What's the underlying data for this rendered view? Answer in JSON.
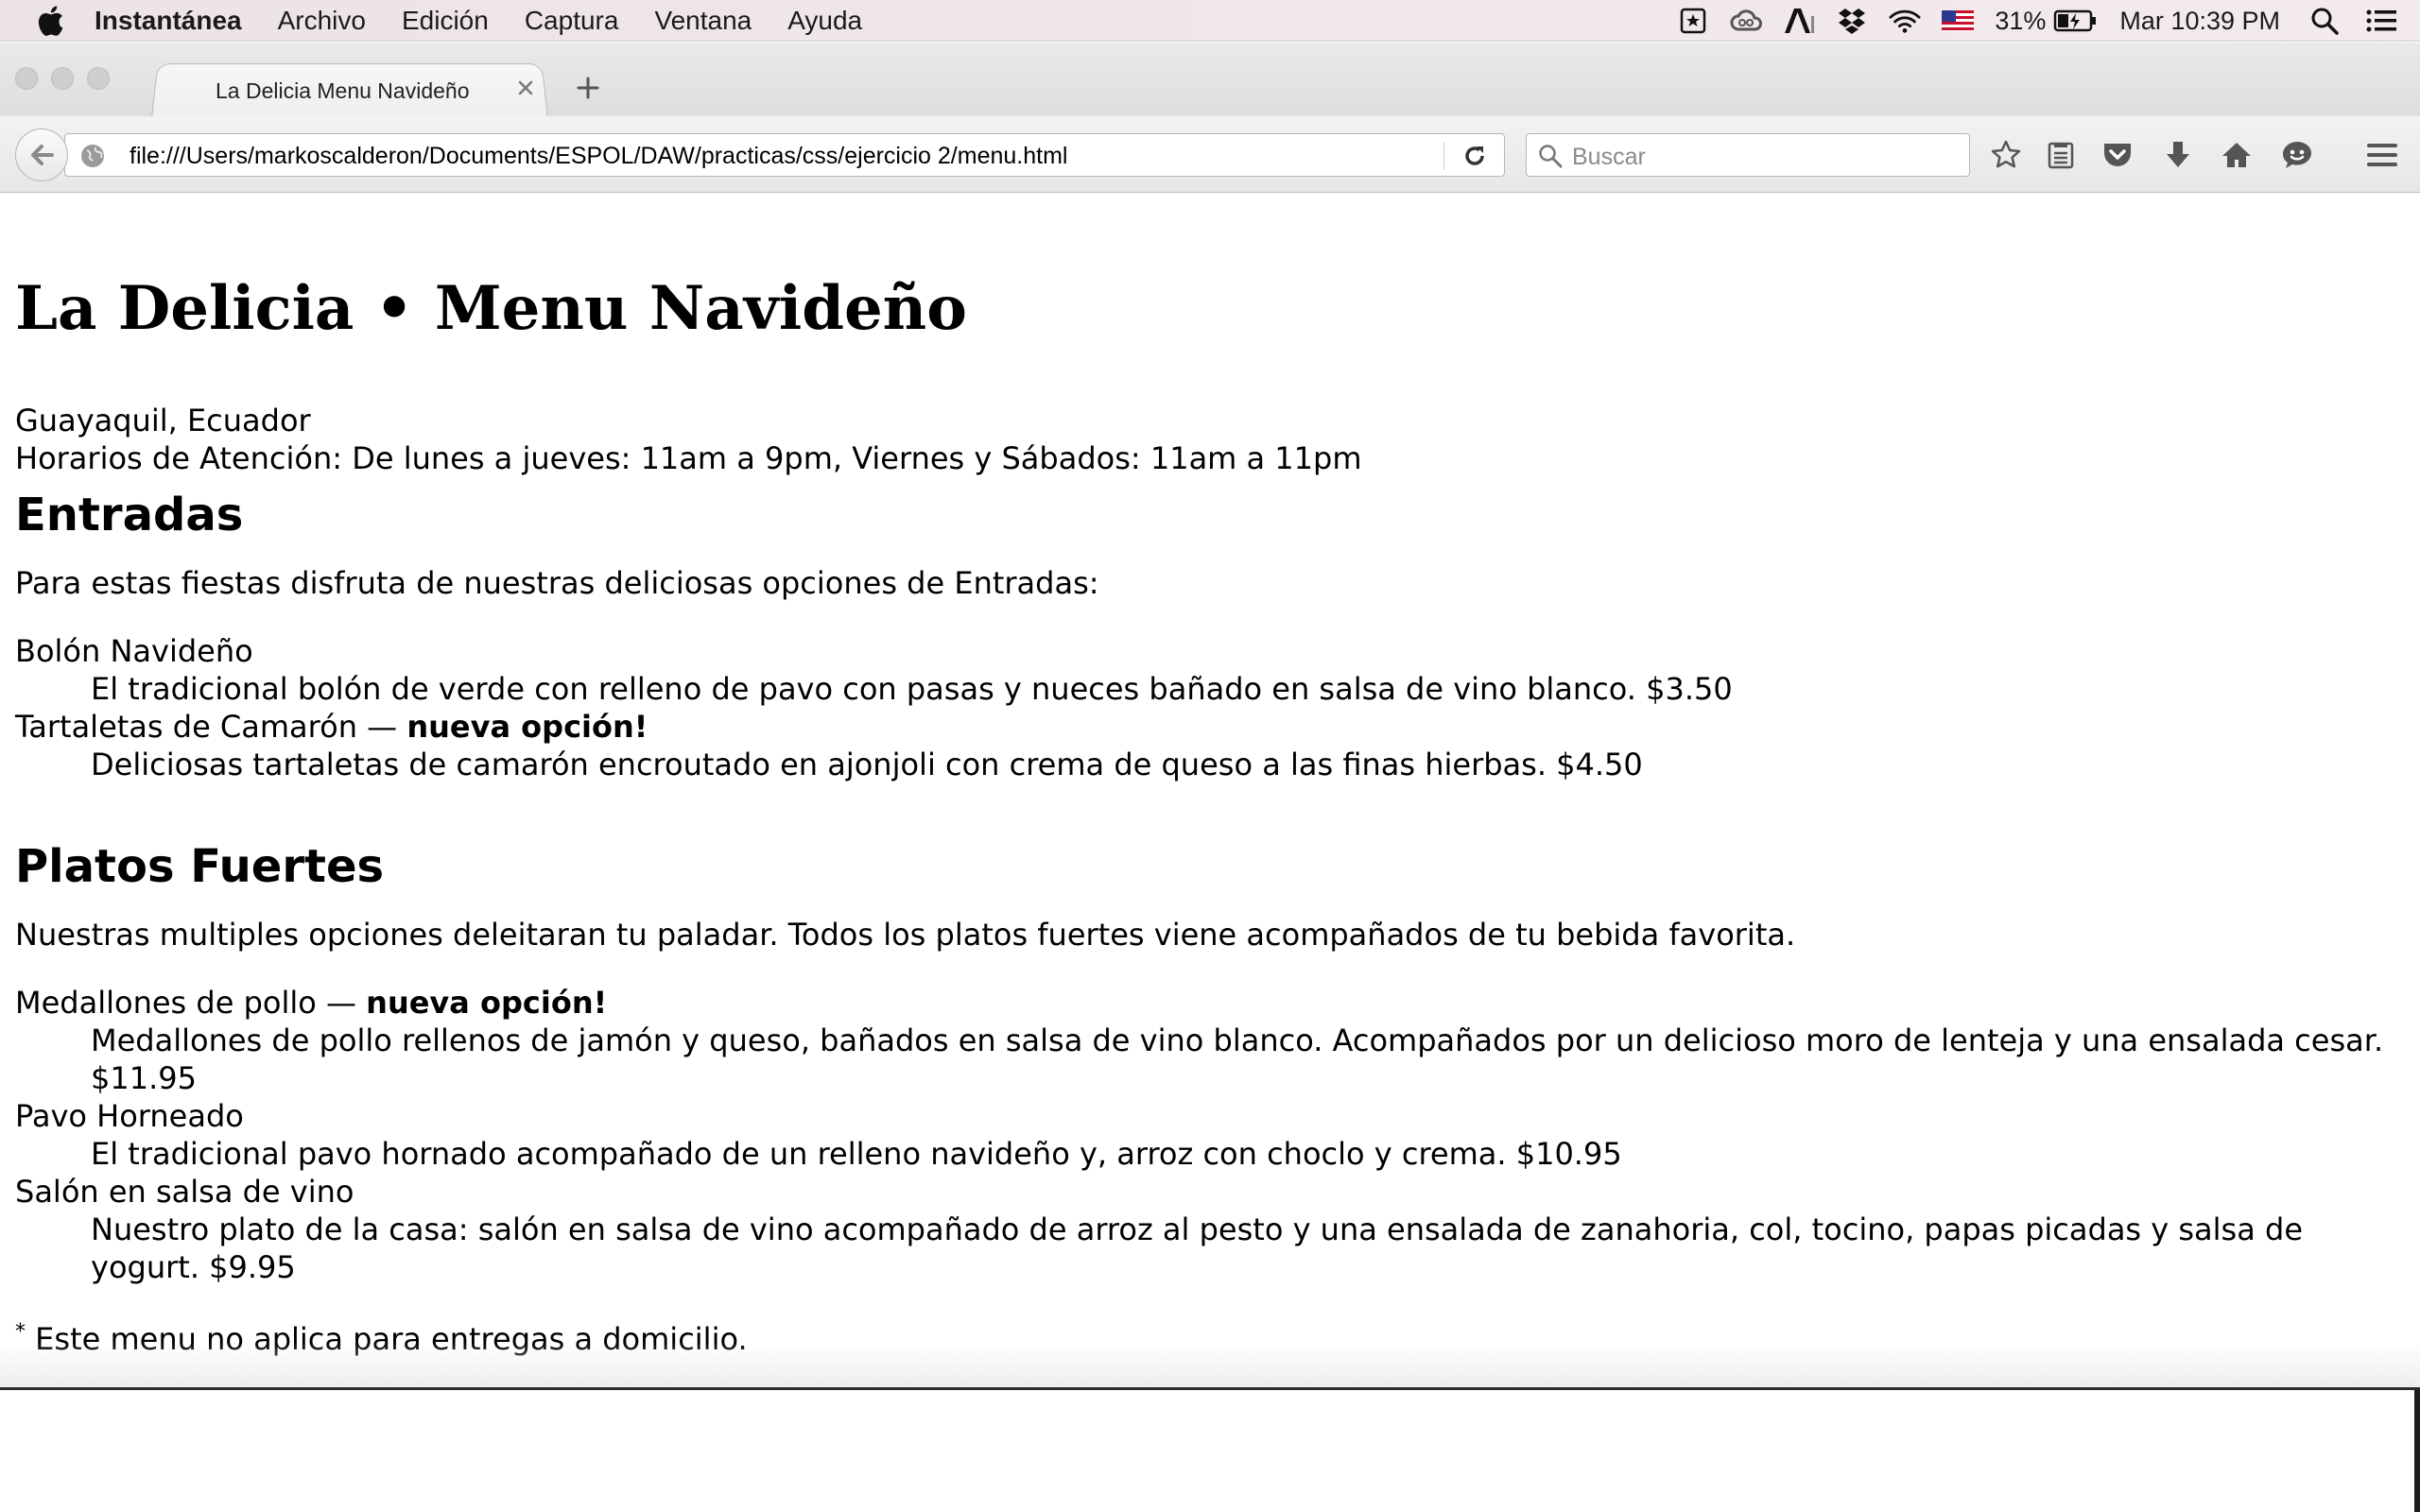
{
  "menubar": {
    "app_name": "Instantánea",
    "items": [
      "Archivo",
      "Edición",
      "Captura",
      "Ventana",
      "Ayuda"
    ],
    "battery": "31%",
    "datetime": "Mar 10:39 PM",
    "icons": [
      "apple-icon",
      "bookmark-app-icon",
      "creative-cloud-icon",
      "adobe-icon",
      "dropbox-icon",
      "wifi-icon",
      "us-flag-icon",
      "battery-icon",
      "spotlight-icon",
      "notification-center-icon"
    ]
  },
  "browser": {
    "tab_title": "La Delicia Menu Navideño",
    "url": "file:///Users/markoscalderon/Documents/ESPOL/DAW/practicas/css/ejercicio 2/menu.html",
    "search_placeholder": "Buscar",
    "toolbar_icons": [
      "bookmark-star-icon",
      "reading-list-icon",
      "pocket-icon",
      "download-icon",
      "home-icon",
      "hello-chat-icon",
      "hamburger-menu-icon"
    ]
  },
  "page": {
    "title": "La Delicia • Menu Navideño",
    "location": "Guayaquil, Ecuador",
    "hours": "Horarios de Atención: De lunes a jueves: 11am a 9pm, Viernes y Sábados: 11am a 11pm",
    "sections": [
      {
        "heading": "Entradas",
        "intro": "Para estas fiestas disfruta de nuestras deliciosas opciones de Entradas:",
        "items": [
          {
            "name": "Bolón Navideño",
            "badge": "",
            "description": "El tradicional bolón de verde con relleno de pavo con pasas y nueces bañado en salsa de vino blanco. $3.50"
          },
          {
            "name": "Tartaletas de Camarón — ",
            "badge": "nueva opción!",
            "description": "Deliciosas tartaletas de camarón encroutado en ajonjoli con crema de queso a las finas hierbas. $4.50"
          }
        ]
      },
      {
        "heading": "Platos Fuertes",
        "intro": "Nuestras multiples opciones deleitaran tu paladar. Todos los platos fuertes viene acompañados de tu bebida favorita.",
        "items": [
          {
            "name": "Medallones de pollo — ",
            "badge": "nueva opción!",
            "description_line1": "Medallones de pollo rellenos de jamón y queso, bañados en salsa de vino blanco. Acompañados por un delicioso moro de lenteja y una ensalada cesar.",
            "description_line2": "$11.95"
          },
          {
            "name": "Pavo Horneado",
            "badge": "",
            "description": "El tradicional pavo hornado acompañado de un relleno navideño y, arroz con choclo y crema. $10.95"
          },
          {
            "name": "Salón en salsa de vino",
            "badge": "",
            "description_line1": "Nuestro plato de la casa: salón en salsa de vino acompañado de arroz al pesto y una ensalada de zanahoria, col, tocino, papas picadas y salsa de",
            "description_line2": "yogurt. $9.95"
          }
        ]
      }
    ],
    "footnote_mark": "*",
    "footnote": " Este menu no aplica para entregas a domicilio."
  }
}
